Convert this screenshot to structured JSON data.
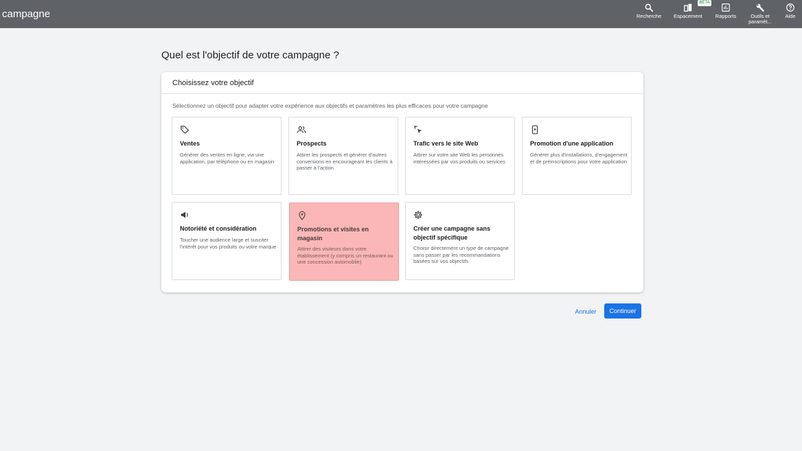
{
  "header": {
    "title": "campagne",
    "tools": [
      {
        "label": "Recherche",
        "icon": "search-icon"
      },
      {
        "label": "Espacement",
        "icon": "columns-icon",
        "badge": "BÊTA"
      },
      {
        "label": "Rapports",
        "icon": "reports-icon"
      },
      {
        "label": "Outils et paramèt...",
        "icon": "wrench-icon"
      },
      {
        "label": "Aide",
        "icon": "help-icon"
      }
    ]
  },
  "page": {
    "title": "Quel est l'objectif de votre campagne ?"
  },
  "card": {
    "title": "Choisissez votre objectif",
    "description": "Sélectionnez un objectif pour adapter votre expérience aux objectifs et paramètres les plus efficaces pour votre campagne"
  },
  "objectives": [
    {
      "icon": "tag-icon",
      "title": "Ventes",
      "desc": "Générer des ventes en ligne, via une application, par téléphone ou en magasin",
      "selected": false
    },
    {
      "icon": "people-icon",
      "title": "Prospects",
      "desc": "Attirer les prospects et générer d'autres conversions en encourageant les clients à passer à l'action",
      "selected": false
    },
    {
      "icon": "cursor-click-icon",
      "title": "Trafic vers le site Web",
      "desc": "Attirer sur votre site Web les personnes intéressées par vos produits ou services",
      "selected": false
    },
    {
      "icon": "phone-icon",
      "title": "Promotion d'une application",
      "desc": "Générer plus d'installations, d'engagement et de préinscriptions pour votre application",
      "selected": false
    },
    {
      "icon": "megaphone-icon",
      "title": "Notoriété et considération",
      "desc": "Toucher une audience large et susciter l'intérêt pour vos produits ou votre marque",
      "selected": false
    },
    {
      "icon": "location-pin-icon",
      "title": "Promotions et visites en magasin",
      "desc": "Attirer des visiteurs dans votre établissement (y compris un restaurant ou une concession automobile)",
      "selected": true
    },
    {
      "icon": "gear-icon",
      "title": "Créer une campagne sans objectif spécifique",
      "desc": "Choisir directement un type de campagne sans passer par les recommandations basées sur vos objectifs",
      "selected": false
    }
  ],
  "actions": {
    "cancel": "Annuler",
    "continue": "Continuer"
  },
  "colors": {
    "topbar": "#5f6368",
    "accent": "#1a73e8",
    "selected_tile": "#fbb7b7"
  }
}
